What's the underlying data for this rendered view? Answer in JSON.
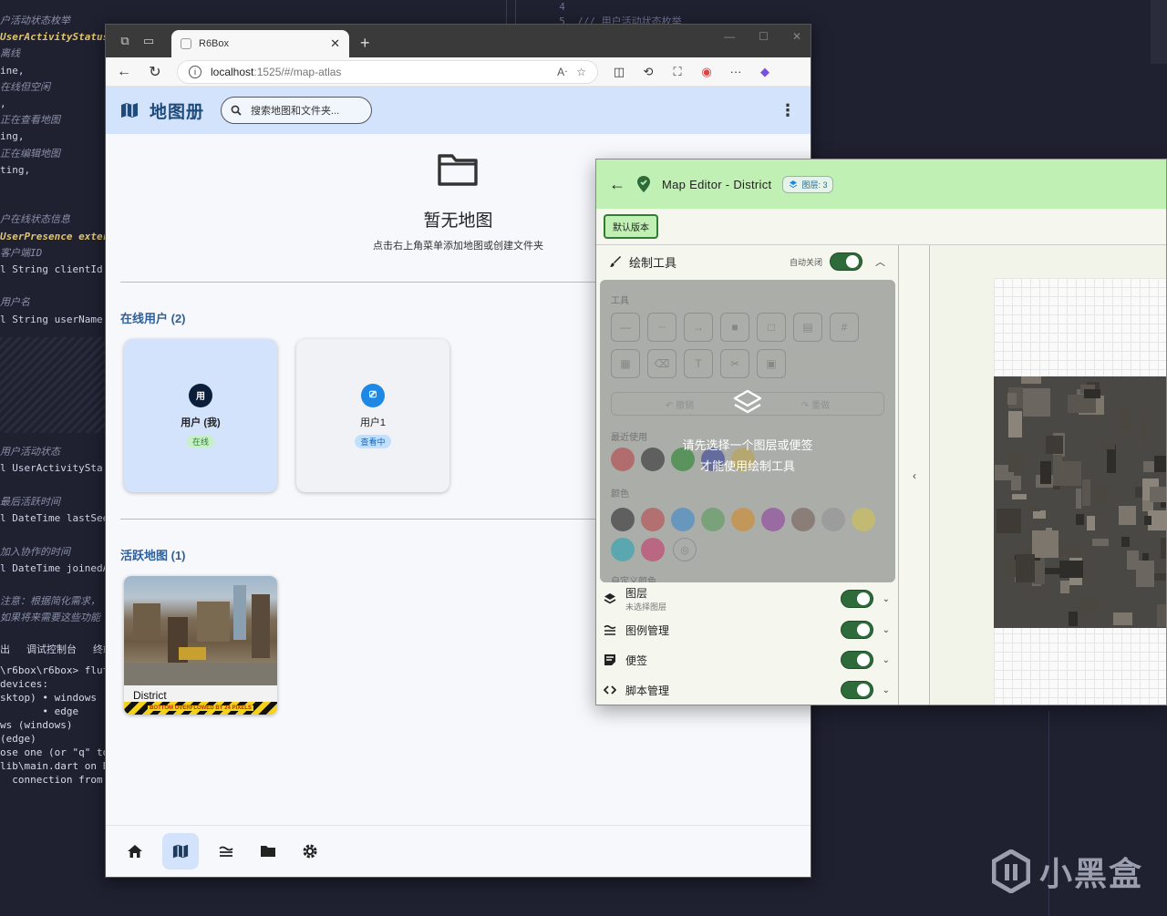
{
  "code_editor": {
    "lines": [
      {
        "t": "户活动状态枚举",
        "c": "cm"
      },
      {
        "t": "UserActivityStatus",
        "c": "ty"
      },
      {
        "t": "离线",
        "c": "cm"
      },
      {
        "t": "ine,",
        "c": "kw"
      },
      {
        "t": "在线但空闲",
        "c": "cm"
      },
      {
        "t": ",",
        "c": "kw"
      },
      {
        "t": "正在查看地图",
        "c": "cm"
      },
      {
        "t": "ing,",
        "c": "kw"
      },
      {
        "t": "正在编辑地图",
        "c": "cm"
      },
      {
        "t": "ting,",
        "c": "kw"
      },
      {
        "t": "",
        "c": "kw"
      },
      {
        "t": "",
        "c": "kw"
      },
      {
        "t": "户在线状态信息",
        "c": "cm"
      },
      {
        "t": "UserPresence exter",
        "c": "ty"
      },
      {
        "t": "客户端ID",
        "c": "cm"
      },
      {
        "t": "l String clientId;",
        "c": "kw"
      },
      {
        "t": "",
        "c": "kw"
      },
      {
        "t": "用户名",
        "c": "cm"
      },
      {
        "t": "l String userName;",
        "c": "kw"
      },
      {
        "t": "",
        "c": "kw"
      },
      {
        "t": "",
        "c": "kw"
      },
      {
        "t": "",
        "c": "kw"
      },
      {
        "t": "",
        "c": "kw"
      },
      {
        "t": "",
        "c": "kw"
      },
      {
        "t": "",
        "c": "kw"
      },
      {
        "t": "",
        "c": "kw"
      },
      {
        "t": "用户活动状态",
        "c": "cm"
      },
      {
        "t": "l UserActivitySta",
        "c": "kw"
      },
      {
        "t": "",
        "c": "kw"
      },
      {
        "t": "最后活跃时间",
        "c": "cm"
      },
      {
        "t": "l DateTime lastSee",
        "c": "kw"
      },
      {
        "t": "",
        "c": "kw"
      },
      {
        "t": "加入协作的时间",
        "c": "cm"
      },
      {
        "t": "l DateTime joinedA",
        "c": "kw"
      },
      {
        "t": "",
        "c": "kw"
      },
      {
        "t": "注意：根据简化需求，",
        "c": "cm"
      },
      {
        "t": "如果将来需要这些功能",
        "c": "cm"
      }
    ],
    "terminal_tabs": [
      "出",
      "调试控制台",
      "终端"
    ],
    "terminal_lines": [
      "\\r6box\\r6box> flut",
      "devices:",
      "sktop) • windows",
      "       • edge",
      "ws (windows)",
      "(edge)",
      "ose one (or \"q\" to",
      "lib\\main.dart on E",
      "  connection from"
    ],
    "right_lines": [
      "  4",
      "  5  /// 用户活动状态枚举"
    ]
  },
  "browser": {
    "tab_title": "R6Box",
    "url_host": "localhost",
    "url_path": ":1525/#/map-atlas",
    "new_tab": "+",
    "window_controls": [
      "—",
      "☐",
      "✕"
    ]
  },
  "app": {
    "title": "地图册",
    "search_placeholder": "搜索地图和文件夹...",
    "empty_title": "暂无地图",
    "empty_subtitle": "点击右上角菜单添加地图或创建文件夹",
    "online_users_title": "在线用户 (2)",
    "users": [
      {
        "avatar": "用",
        "name": "用户 (我)",
        "status": "在线",
        "avatar_color": "#0b1f3a",
        "badge_bg": "#c8f0c8",
        "badge_fg": "#2e7d32",
        "card_bg": "#d3e3fc"
      },
      {
        "avatar": "⎚",
        "name": "用户1",
        "status": "查看中",
        "avatar_color": "#1e88e5",
        "badge_bg": "#bfe0ff",
        "badge_fg": "#1565c0",
        "card_bg": "#f1f2f6"
      }
    ],
    "active_maps_title": "活跃地图 (1)",
    "maps": [
      {
        "name": "District",
        "overflow_msg": "BOTTOM OVERFLOWED BY 24 PIXELS"
      }
    ],
    "nav": [
      "home-icon",
      "map-icon",
      "legend-icon",
      "folder-icon",
      "settings-icon"
    ],
    "nav_active": "map-icon"
  },
  "editor": {
    "title": "Map Editor - District",
    "layer_chip": "图层: 3",
    "version_button": "默认版本",
    "draw_tools": {
      "title": "绘制工具",
      "auto_close": "自动关闭",
      "tools_label": "工具",
      "undo": "撤销",
      "redo": "重做",
      "recent_label": "最近使用",
      "colors_label": "颜色",
      "custom_label": "自定义颜色",
      "overlay_line1": "请先选择一个图层或便签",
      "overlay_line2": "才能使用绘制工具",
      "recent_colors": [
        "#e26d6d",
        "#555555",
        "#4caf50",
        "#5c6bc0",
        "#e8d070"
      ],
      "palette_colors": [
        "#555555",
        "#e57373",
        "#64b5f6",
        "#81c784",
        "#ffb74d",
        "#ba68c8",
        "#a1887f",
        "#bdbdbd",
        "#fff176",
        "#4dd0e1",
        "#f06292"
      ]
    },
    "sections": [
      {
        "label": "图层",
        "sub": "未选择图层",
        "icon": "layers-icon"
      },
      {
        "label": "图例管理",
        "sub": "",
        "icon": "legend-icon"
      },
      {
        "label": "便签",
        "sub": "",
        "icon": "note-icon"
      },
      {
        "label": "脚本管理",
        "sub": "",
        "icon": "code-icon"
      }
    ],
    "collapse": "‹"
  },
  "watermark": "小黑盒"
}
